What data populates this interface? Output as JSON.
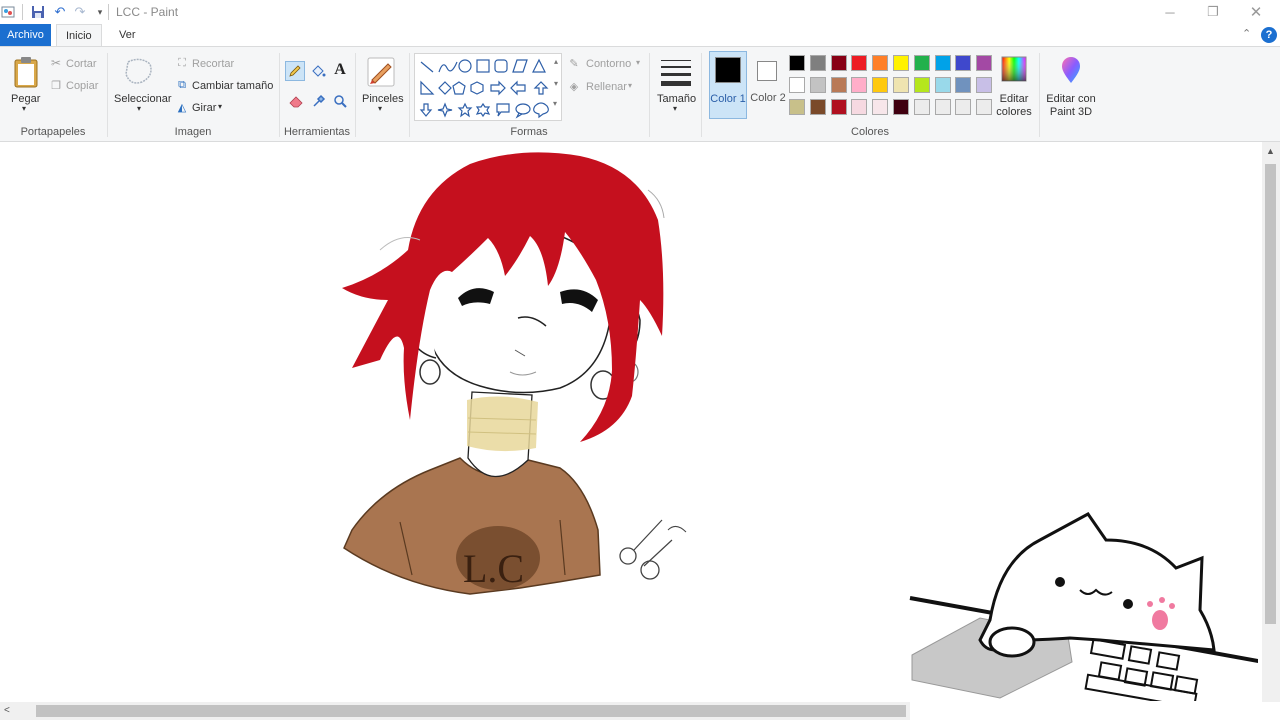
{
  "window": {
    "title": "LCC - Paint"
  },
  "tabs": {
    "file": "Archivo",
    "home": "Inicio",
    "view": "Ver"
  },
  "clipboard": {
    "paste": "Pegar",
    "cut": "Cortar",
    "copy": "Copiar",
    "label": "Portapapeles"
  },
  "image": {
    "select": "Seleccionar",
    "crop": "Recortar",
    "resize": "Cambiar tamaño",
    "rotate": "Girar",
    "label": "Imagen"
  },
  "tools": {
    "label": "Herramientas"
  },
  "brushes": {
    "label": "Pinceles"
  },
  "shapes": {
    "outline": "Contorno",
    "fill": "Rellenar",
    "label": "Formas"
  },
  "size": {
    "label": "Tamaño"
  },
  "colors": {
    "color1": "Color 1",
    "color2": "Color 2",
    "edit": "Editar colores",
    "label": "Colores",
    "color1_value": "#000000",
    "color2_value": "#ffffff",
    "palette_row1": [
      "#000000",
      "#7f7f7f",
      "#880015",
      "#ed1c24",
      "#ff7f27",
      "#fff200",
      "#22b14c",
      "#00a2e8",
      "#3f48cc",
      "#a349a4"
    ],
    "palette_row2": [
      "#ffffff",
      "#c3c3c3",
      "#b97a57",
      "#ffaec9",
      "#ffc90e",
      "#efe4b0",
      "#b5e61d",
      "#99d9ea",
      "#7092be",
      "#c8bfe7"
    ],
    "palette_row3": [
      "#c8c08a",
      "#7a4a2a",
      "#b01020",
      "#f6d9e1",
      "#f7e6ea",
      "#400010",
      "#ececec",
      "#ececec",
      "#ececec",
      "#ececec"
    ]
  },
  "paint3d": {
    "label": "Editar con Paint 3D"
  },
  "drawing": {
    "shirt_text": "L.C"
  }
}
